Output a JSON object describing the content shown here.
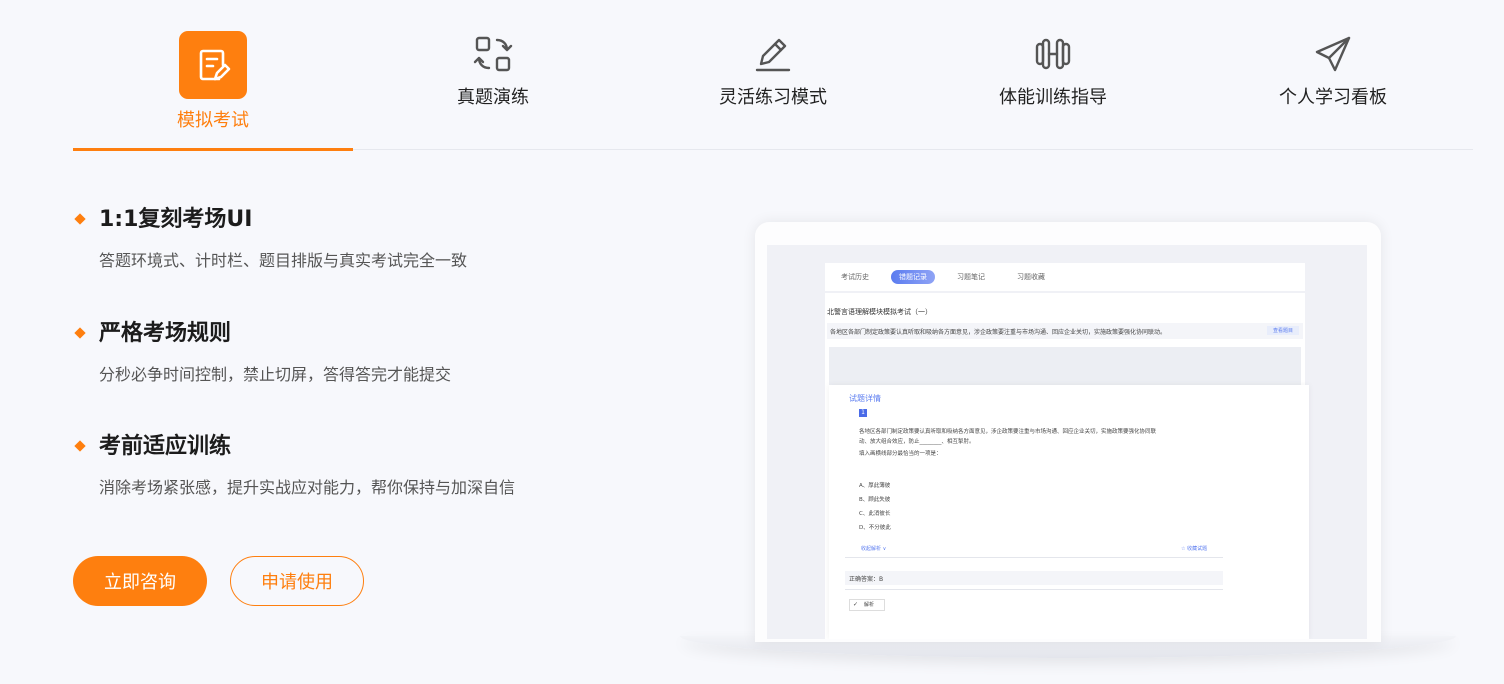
{
  "tabs": [
    {
      "label": "模拟考试",
      "icon": "exam-note-icon",
      "active": true
    },
    {
      "label": "真题演练",
      "icon": "refresh-icon",
      "active": false
    },
    {
      "label": "灵活练习模式",
      "icon": "pen-icon",
      "active": false
    },
    {
      "label": "体能训练指导",
      "icon": "dumbbell-icon",
      "active": false
    },
    {
      "label": "个人学习看板",
      "icon": "paper-plane-icon",
      "active": false
    }
  ],
  "features": [
    {
      "title": "1:1复刻考场UI",
      "desc": "答题环境式、计时栏、题目排版与真实考试完全一致"
    },
    {
      "title": "严格考场规则",
      "desc": "分秒必争时间控制，禁止切屏，答得答完才能提交"
    },
    {
      "title": "考前适应训练",
      "desc": "消除考场紧张感，提升实战应对能力，帮你保持与加深自信"
    }
  ],
  "buttons": {
    "consult": "立即咨询",
    "apply": "申请使用"
  },
  "mockup": {
    "tabs": [
      "考试历史",
      "错题记录",
      "习题笔记",
      "习题收藏"
    ],
    "exam_title": "北警言语理解模块模拟考试（一）",
    "question_preview": "各地区各部门制定政策要认真听取和吸纳各方面意见，涉企政策要注重与市场沟通、回应企业关切，实施政策要强化协同联动。",
    "preview_link": "查看题目",
    "panel_title": "试题详情",
    "q_number": "1",
    "q_line1": "各地区各部门制定政策要认真听取和吸纳各方面意见，涉企政策要注重与市场沟通、回应企业关切，实施政策要强化协同联",
    "q_line2": "动、放大组合效应，防止________、相互掣肘。",
    "q_line3": "填入画横线部分最恰当的一项是：",
    "options": [
      "A、厚此薄彼",
      "B、顾此失彼",
      "C、此消彼长",
      "D、不分彼此"
    ],
    "show_analysis": "收起解析 ∨",
    "favorite": "☆ 收藏试题",
    "answer": "正确答案：B",
    "analysis_btn": "解析"
  },
  "colors": {
    "accent": "#fe7f0f",
    "mockup_blue": "#5b7cf0"
  }
}
